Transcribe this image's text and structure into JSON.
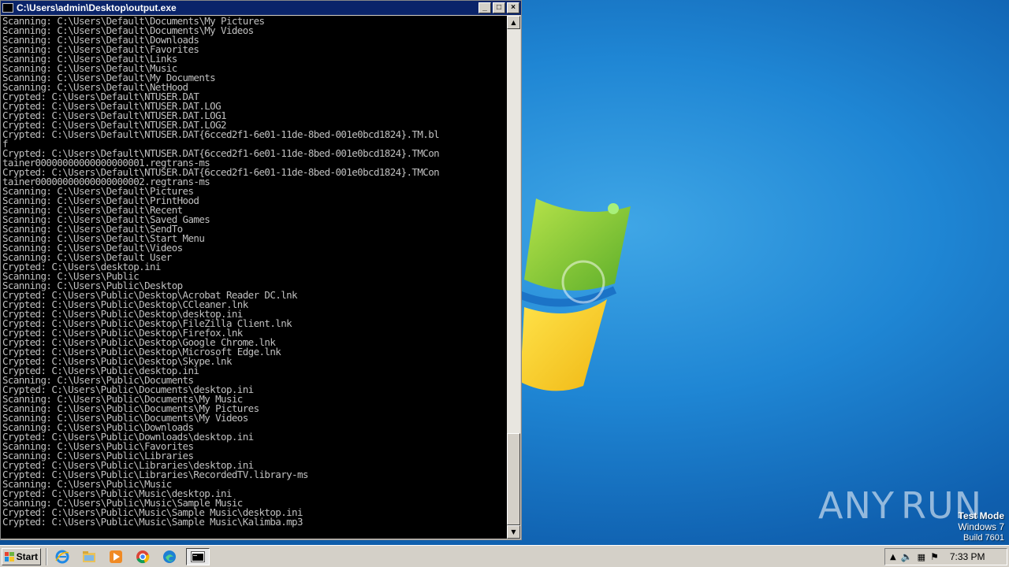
{
  "window": {
    "title": "C:\\Users\\admin\\Desktop\\output.exe",
    "buttons": {
      "minimize": "_",
      "maximize": "□",
      "close": "×"
    }
  },
  "console": {
    "lines": [
      "Scanning: C:\\Users\\Default\\Documents\\My Pictures",
      "Scanning: C:\\Users\\Default\\Documents\\My Videos",
      "Scanning: C:\\Users\\Default\\Downloads",
      "Scanning: C:\\Users\\Default\\Favorites",
      "Scanning: C:\\Users\\Default\\Links",
      "Scanning: C:\\Users\\Default\\Music",
      "Scanning: C:\\Users\\Default\\My Documents",
      "Scanning: C:\\Users\\Default\\NetHood",
      "Crypted: C:\\Users\\Default\\NTUSER.DAT",
      "Crypted: C:\\Users\\Default\\NTUSER.DAT.LOG",
      "Crypted: C:\\Users\\Default\\NTUSER.DAT.LOG1",
      "Crypted: C:\\Users\\Default\\NTUSER.DAT.LOG2",
      "Crypted: C:\\Users\\Default\\NTUSER.DAT{6cced2f1-6e01-11de-8bed-001e0bcd1824}.TM.bl",
      "f",
      "Crypted: C:\\Users\\Default\\NTUSER.DAT{6cced2f1-6e01-11de-8bed-001e0bcd1824}.TMCon",
      "tainer00000000000000000001.regtrans-ms",
      "Crypted: C:\\Users\\Default\\NTUSER.DAT{6cced2f1-6e01-11de-8bed-001e0bcd1824}.TMCon",
      "tainer00000000000000000002.regtrans-ms",
      "Scanning: C:\\Users\\Default\\Pictures",
      "Scanning: C:\\Users\\Default\\PrintHood",
      "Scanning: C:\\Users\\Default\\Recent",
      "Scanning: C:\\Users\\Default\\Saved Games",
      "Scanning: C:\\Users\\Default\\SendTo",
      "Scanning: C:\\Users\\Default\\Start Menu",
      "Scanning: C:\\Users\\Default\\Videos",
      "Scanning: C:\\Users\\Default User",
      "Crypted: C:\\Users\\desktop.ini",
      "Scanning: C:\\Users\\Public",
      "Scanning: C:\\Users\\Public\\Desktop",
      "Crypted: C:\\Users\\Public\\Desktop\\Acrobat Reader DC.lnk",
      "Crypted: C:\\Users\\Public\\Desktop\\CCleaner.lnk",
      "Crypted: C:\\Users\\Public\\Desktop\\desktop.ini",
      "Crypted: C:\\Users\\Public\\Desktop\\FileZilla Client.lnk",
      "Crypted: C:\\Users\\Public\\Desktop\\Firefox.lnk",
      "Crypted: C:\\Users\\Public\\Desktop\\Google Chrome.lnk",
      "Crypted: C:\\Users\\Public\\Desktop\\Microsoft Edge.lnk",
      "Crypted: C:\\Users\\Public\\Desktop\\Skype.lnk",
      "Crypted: C:\\Users\\Public\\desktop.ini",
      "Scanning: C:\\Users\\Public\\Documents",
      "Crypted: C:\\Users\\Public\\Documents\\desktop.ini",
      "Scanning: C:\\Users\\Public\\Documents\\My Music",
      "Scanning: C:\\Users\\Public\\Documents\\My Pictures",
      "Scanning: C:\\Users\\Public\\Documents\\My Videos",
      "Scanning: C:\\Users\\Public\\Downloads",
      "Crypted: C:\\Users\\Public\\Downloads\\desktop.ini",
      "Scanning: C:\\Users\\Public\\Favorites",
      "Scanning: C:\\Users\\Public\\Libraries",
      "Crypted: C:\\Users\\Public\\Libraries\\desktop.ini",
      "Crypted: C:\\Users\\Public\\Libraries\\RecordedTV.library-ms",
      "Scanning: C:\\Users\\Public\\Music",
      "Crypted: C:\\Users\\Public\\Music\\desktop.ini",
      "Scanning: C:\\Users\\Public\\Music\\Sample Music",
      "Crypted: C:\\Users\\Public\\Music\\Sample Music\\desktop.ini",
      "Crypted: C:\\Users\\Public\\Music\\Sample Music\\Kalimba.mp3"
    ]
  },
  "desktop": {
    "watermark": {
      "left": "ANY",
      "right": "RUN"
    },
    "test_mode": {
      "line1": "Test Mode",
      "line2": "Windows 7",
      "line3": "Build 7601"
    }
  },
  "taskbar": {
    "start_label": "Start",
    "pinned": [
      "ie-icon",
      "explorer-icon",
      "media-player-icon",
      "chrome-icon",
      "edge-icon",
      "console-icon"
    ],
    "clock": "7:33 PM"
  }
}
